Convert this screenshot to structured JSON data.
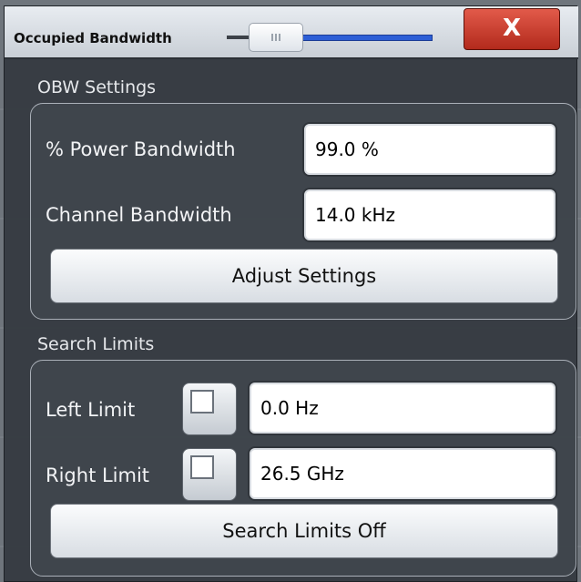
{
  "dialog": {
    "title": "Occupied Bandwidth",
    "close_label": "X",
    "accent_close": "#c8392b",
    "accent_slider": "#2c5ed6"
  },
  "obw_settings": {
    "label": "OBW Settings",
    "power_bandwidth_label": "% Power Bandwidth",
    "power_bandwidth_value": "99.0 %",
    "channel_bandwidth_label": "Channel Bandwidth",
    "channel_bandwidth_value": "14.0 kHz",
    "adjust_button": "Adjust Settings"
  },
  "search_limits": {
    "label": "Search Limits",
    "left_limit_label": "Left Limit",
    "left_limit_checked": false,
    "left_limit_value": "0.0 Hz",
    "right_limit_label": "Right Limit",
    "right_limit_checked": false,
    "right_limit_value": "26.5 GHz",
    "off_button": "Search Limits Off"
  },
  "icons": {
    "close": "close-icon",
    "slider": "transparency-slider"
  }
}
